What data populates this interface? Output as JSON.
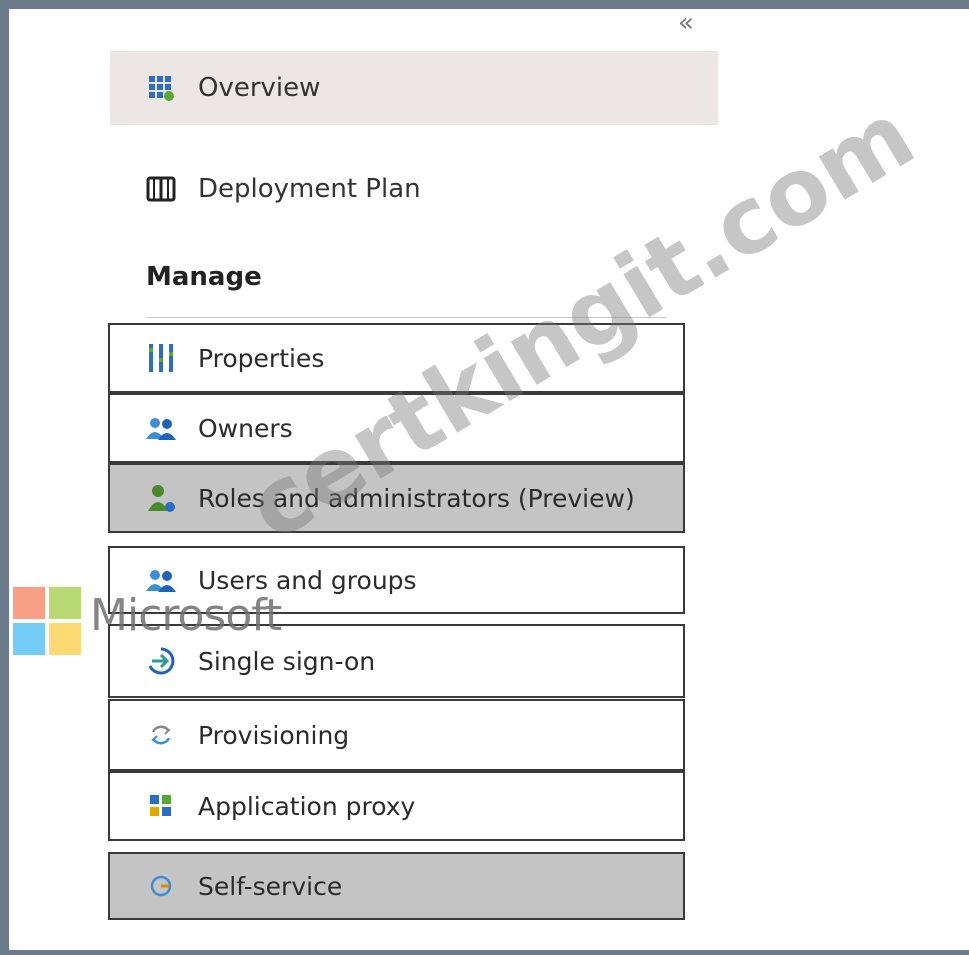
{
  "sidebar": {
    "collapse_glyph": "«",
    "top_items": [
      {
        "label": "Overview",
        "icon": "overview-grid-icon",
        "selected": true
      },
      {
        "label": "Deployment Plan",
        "icon": "book-icon",
        "selected": false
      }
    ],
    "section_title": "Manage",
    "manage_items": [
      {
        "label": "Properties",
        "icon": "properties-bars-icon",
        "shaded": false
      },
      {
        "label": "Owners",
        "icon": "people-icon",
        "shaded": false
      },
      {
        "label": "Roles and administrators (Preview)",
        "icon": "user-roles-icon",
        "shaded": true
      },
      {
        "label": "Users and groups",
        "icon": "people-icon",
        "shaded": false
      },
      {
        "label": "Single sign-on",
        "icon": "sign-in-arrow-icon",
        "shaded": false
      },
      {
        "label": "Provisioning",
        "icon": "sync-icon",
        "shaded": false
      },
      {
        "label": "Application proxy",
        "icon": "app-proxy-icon",
        "shaded": false
      },
      {
        "label": "Self-service",
        "icon": "self-service-icon",
        "shaded": true
      }
    ]
  },
  "overlay": {
    "microsoft_text": "Microsoft",
    "watermark_text": "certkingit.com"
  },
  "colors": {
    "frame": "#6b7b8c",
    "selected_bg": "#ece6e4",
    "shaded_bg": "#c4c4c4",
    "ms_red": "#f25022",
    "ms_green": "#7fba00",
    "ms_blue": "#00a4ef",
    "ms_yellow": "#ffb900"
  }
}
